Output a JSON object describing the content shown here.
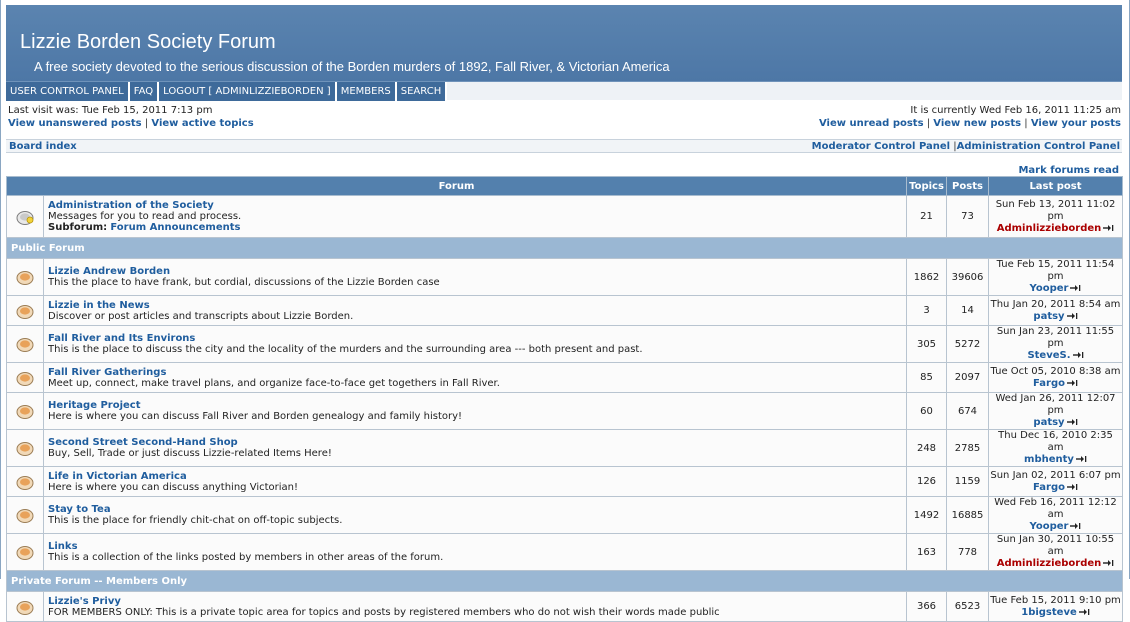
{
  "site": {
    "title": "Lizzie Borden Society Forum",
    "description": "A free society devoted to the serious discussion of the Borden murders of 1892, Fall River, & Victorian America"
  },
  "nav": {
    "items": [
      "USER CONTROL PANEL",
      "FAQ",
      "LOGOUT [ ADMINLIZZIEBORDEN ]",
      "MEMBERS",
      "SEARCH"
    ]
  },
  "info": {
    "last_visit": "Last visit was: Tue Feb 15, 2011 7:13 pm",
    "current_time": "It is currently Wed Feb 16, 2011 11:25 am",
    "left_links": [
      "View unanswered posts",
      "View active topics"
    ],
    "right_links": [
      "View unread posts",
      "View new posts",
      "View your posts"
    ]
  },
  "breadcrumb": {
    "board_index": "Board index",
    "moderator_cp": "Moderator Control Panel",
    "admin_cp": "Administration Control Panel"
  },
  "mark_read": "Mark forums read",
  "table": {
    "headers": {
      "forum": "Forum",
      "topics": "Topics",
      "posts": "Posts",
      "last_post": "Last post"
    },
    "first_forum": {
      "name": "Administration of the Society",
      "desc": "Messages for you to read and process.",
      "subforum_label": "Subforum:",
      "subforum_name": "Forum Announcements",
      "topics": "21",
      "posts": "73",
      "last_date": "Sun Feb 13, 2011 11:02 pm",
      "last_author": "Adminlizzieborden"
    },
    "categories": [
      {
        "name": "Public Forum",
        "forums": [
          {
            "name": "Lizzie Andrew Borden",
            "desc": "This the place to have frank, but cordial, discussions of the Lizzie Borden case",
            "topics": "1862",
            "posts": "39606",
            "last_date": "Tue Feb 15, 2011 11:54 pm",
            "last_author": "Yooper"
          },
          {
            "name": "Lizzie in the News",
            "desc": "Discover or post articles and transcripts about Lizzie Borden.",
            "topics": "3",
            "posts": "14",
            "last_date": "Thu Jan 20, 2011 8:54 am",
            "last_author": "patsy"
          },
          {
            "name": "Fall River and Its Environs",
            "desc": "This is the place to discuss the city and the locality of the murders and the surrounding area --- both present and past.",
            "topics": "305",
            "posts": "5272",
            "last_date": "Sun Jan 23, 2011 11:55 pm",
            "last_author": "SteveS."
          },
          {
            "name": "Fall River Gatherings",
            "desc": "Meet up, connect, make travel plans, and organize face-to-face get togethers in Fall River.",
            "topics": "85",
            "posts": "2097",
            "last_date": "Tue Oct 05, 2010 8:38 am",
            "last_author": "Fargo"
          },
          {
            "name": "Heritage Project",
            "desc": "Here is where you can discuss Fall River and Borden genealogy and family history!",
            "topics": "60",
            "posts": "674",
            "last_date": "Wed Jan 26, 2011 12:07 pm",
            "last_author": "patsy"
          },
          {
            "name": "Second Street Second-Hand Shop",
            "desc": "Buy, Sell, Trade or just discuss Lizzie-related Items Here!",
            "topics": "248",
            "posts": "2785",
            "last_date": "Thu Dec 16, 2010 2:35 am",
            "last_author": "mbhenty"
          },
          {
            "name": "Life in Victorian America",
            "desc": "Here is where you can discuss anything Victorian!",
            "topics": "126",
            "posts": "1159",
            "last_date": "Sun Jan 02, 2011 6:07 pm",
            "last_author": "Fargo"
          },
          {
            "name": "Stay to Tea",
            "desc": "This is the place for friendly chit-chat on off-topic subjects.",
            "topics": "1492",
            "posts": "16885",
            "last_date": "Wed Feb 16, 2011 12:12 am",
            "last_author": "Yooper"
          },
          {
            "name": "Links",
            "desc": "This is a collection of the links posted by members in other areas of the forum.",
            "topics": "163",
            "posts": "778",
            "last_date": "Sun Jan 30, 2011 10:55 am",
            "last_author": "Adminlizzieborden",
            "admin": true
          }
        ]
      },
      {
        "name": "Private Forum -- Members Only",
        "forums": [
          {
            "name": "Lizzie's Privy",
            "desc": "FOR MEMBERS ONLY: This is a private topic area for topics and posts by registered members who do not wish their words made public",
            "topics": "366",
            "posts": "6523",
            "last_date": "Tue Feb 15, 2011 9:10 pm",
            "last_author": "1bigsteve"
          }
        ]
      }
    ]
  },
  "icons": {
    "forum_read": "forum-read-icon",
    "forum_unread": "forum-unread-icon",
    "goto_last": "goto-last-post-icon"
  },
  "colors": {
    "header_bg": "#4d77a6",
    "nav_bg": "#3e6a9a",
    "category_bg": "#9ab7d3",
    "link": "#1f5d9e",
    "admin_author": "#aa0000"
  }
}
